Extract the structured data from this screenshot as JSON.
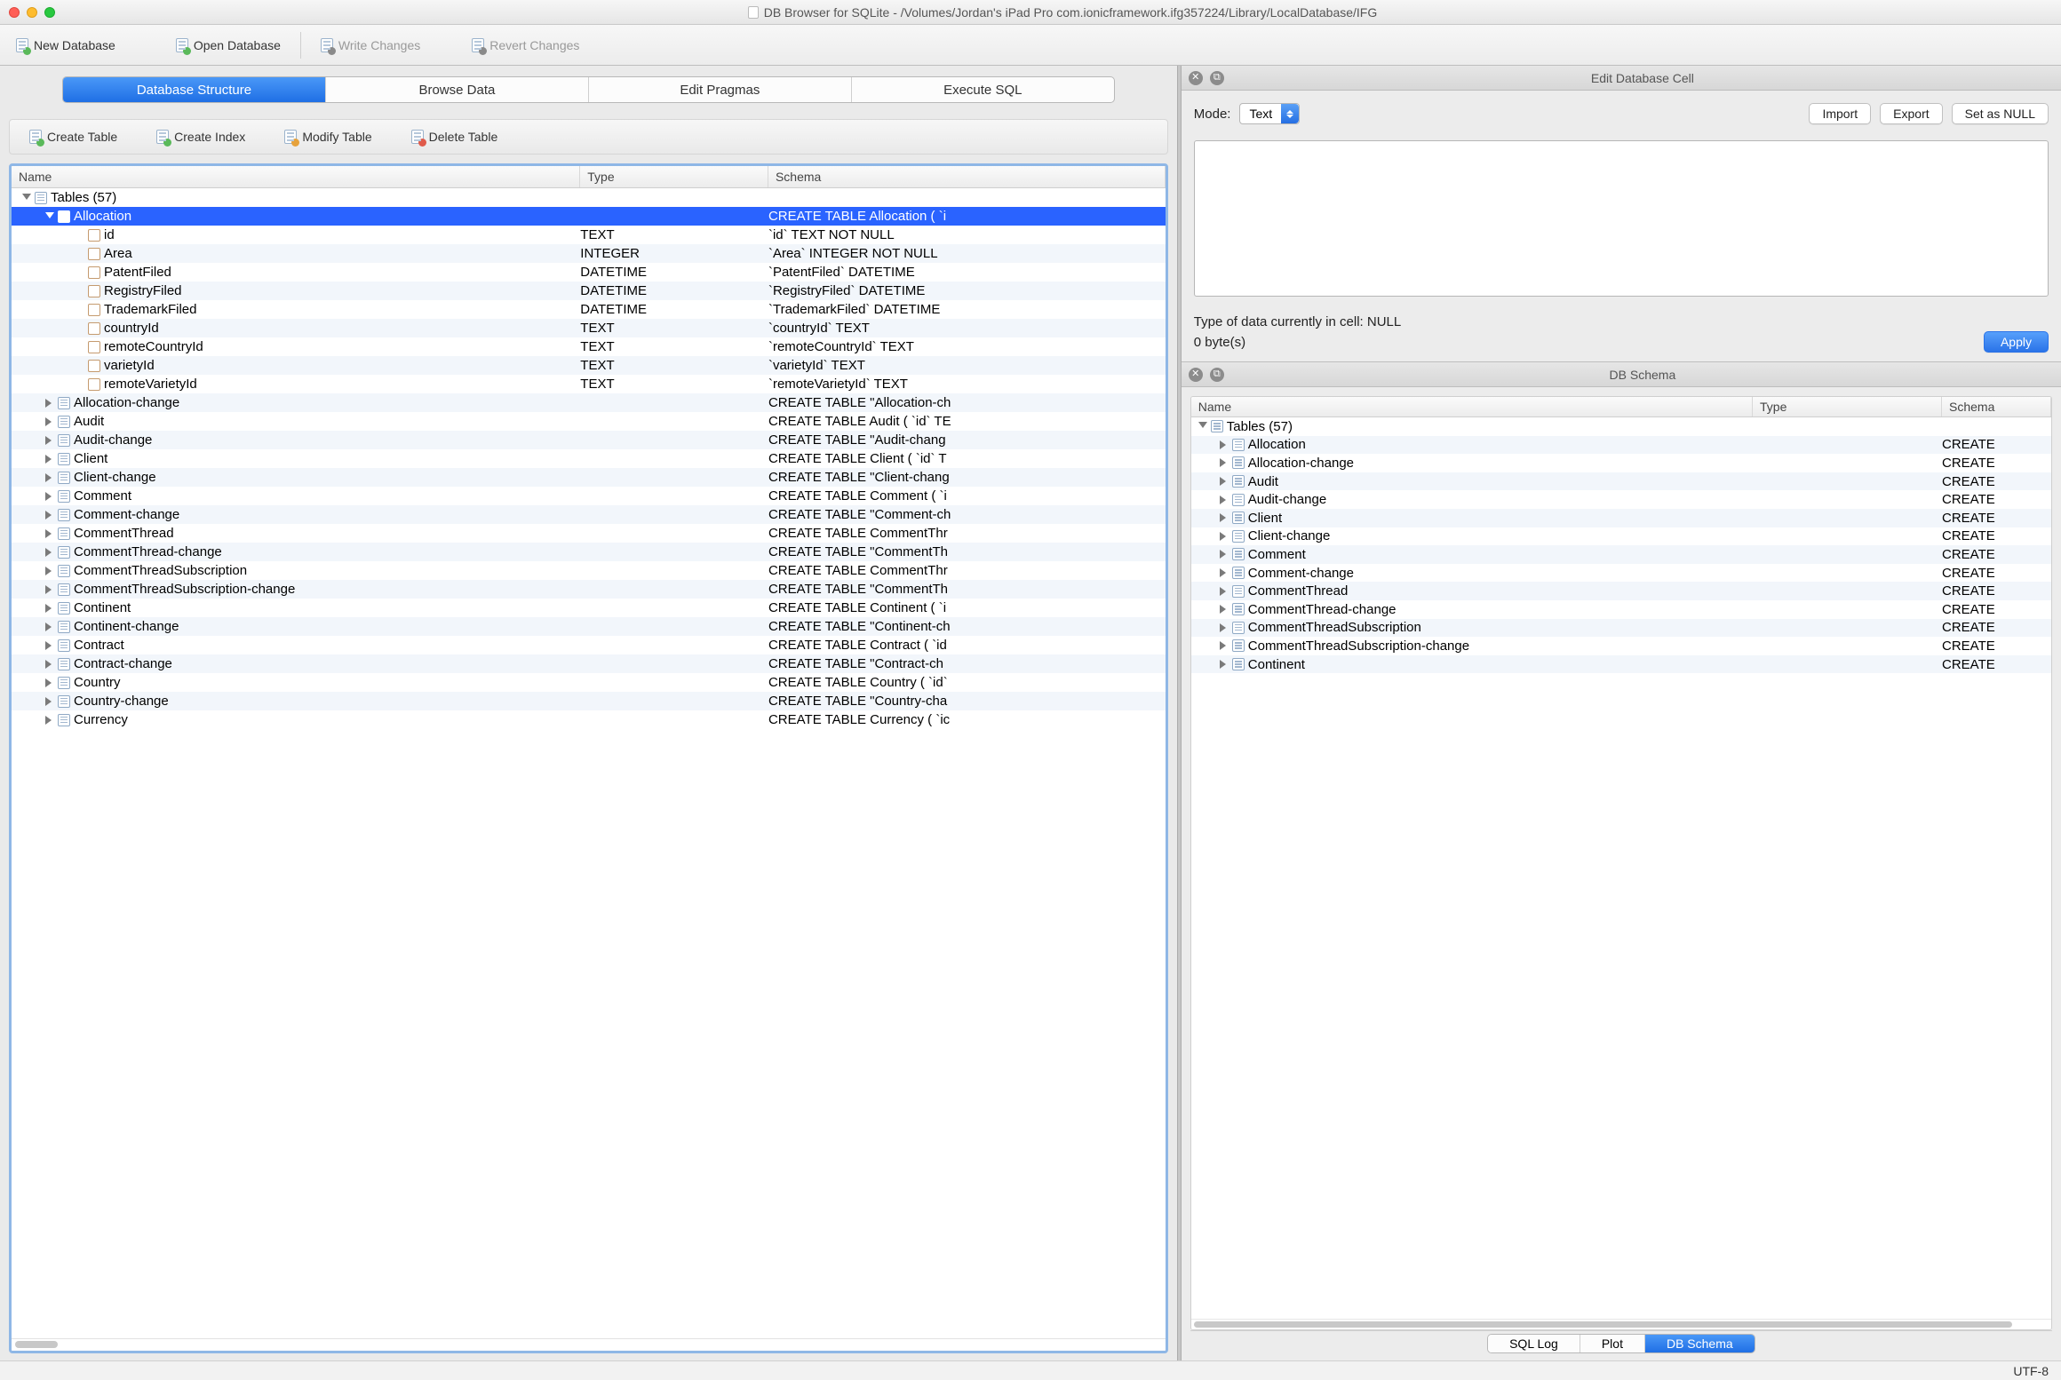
{
  "window": {
    "title": "DB Browser for SQLite - /Volumes/Jordan's iPad Pro com.ionicframework.ifg357224/Library/LocalDatabase/IFG"
  },
  "toolbar": {
    "new_db": "New Database",
    "open_db": "Open Database",
    "write_changes": "Write Changes",
    "revert_changes": "Revert Changes"
  },
  "main_tabs": {
    "structure": "Database Structure",
    "browse": "Browse Data",
    "pragmas": "Edit Pragmas",
    "execute": "Execute SQL"
  },
  "inner_toolbar": {
    "create_table": "Create Table",
    "create_index": "Create Index",
    "modify_table": "Modify Table",
    "delete_table": "Delete Table"
  },
  "tree_headers": {
    "name": "Name",
    "type": "Type",
    "schema": "Schema"
  },
  "tables_header": "Tables (57)",
  "allocation": {
    "name": "Allocation",
    "schema": "CREATE TABLE Allocation ( `i",
    "cols": [
      {
        "name": "id",
        "type": "TEXT",
        "schema": "`id` TEXT NOT NULL"
      },
      {
        "name": "Area",
        "type": "INTEGER",
        "schema": "`Area` INTEGER NOT NULL"
      },
      {
        "name": "PatentFiled",
        "type": "DATETIME",
        "schema": "`PatentFiled` DATETIME"
      },
      {
        "name": "RegistryFiled",
        "type": "DATETIME",
        "schema": "`RegistryFiled` DATETIME"
      },
      {
        "name": "TrademarkFiled",
        "type": "DATETIME",
        "schema": "`TrademarkFiled` DATETIME"
      },
      {
        "name": "countryId",
        "type": "TEXT",
        "schema": "`countryId` TEXT"
      },
      {
        "name": "remoteCountryId",
        "type": "TEXT",
        "schema": "`remoteCountryId` TEXT"
      },
      {
        "name": "varietyId",
        "type": "TEXT",
        "schema": "`varietyId` TEXT"
      },
      {
        "name": "remoteVarietyId",
        "type": "TEXT",
        "schema": "`remoteVarietyId` TEXT"
      }
    ]
  },
  "other_tables": [
    {
      "name": "Allocation-change",
      "schema": "CREATE TABLE \"Allocation-ch"
    },
    {
      "name": "Audit",
      "schema": "CREATE TABLE Audit ( `id` TE"
    },
    {
      "name": "Audit-change",
      "schema": "CREATE TABLE \"Audit-chang"
    },
    {
      "name": "Client",
      "schema": "CREATE TABLE Client ( `id` T"
    },
    {
      "name": "Client-change",
      "schema": "CREATE TABLE \"Client-chang"
    },
    {
      "name": "Comment",
      "schema": "CREATE TABLE Comment ( `i"
    },
    {
      "name": "Comment-change",
      "schema": "CREATE TABLE \"Comment-ch"
    },
    {
      "name": "CommentThread",
      "schema": "CREATE TABLE CommentThr"
    },
    {
      "name": "CommentThread-change",
      "schema": "CREATE TABLE \"CommentTh"
    },
    {
      "name": "CommentThreadSubscription",
      "schema": "CREATE TABLE CommentThr"
    },
    {
      "name": "CommentThreadSubscription-change",
      "schema": "CREATE TABLE \"CommentTh"
    },
    {
      "name": "Continent",
      "schema": "CREATE TABLE Continent ( `i"
    },
    {
      "name": "Continent-change",
      "schema": "CREATE TABLE \"Continent-ch"
    },
    {
      "name": "Contract",
      "schema": "CREATE TABLE Contract ( `id"
    },
    {
      "name": "Contract-change",
      "schema": "CREATE TABLE \"Contract-ch"
    },
    {
      "name": "Country",
      "schema": "CREATE TABLE Country ( `id`"
    },
    {
      "name": "Country-change",
      "schema": "CREATE TABLE \"Country-cha"
    },
    {
      "name": "Currency",
      "schema": "CREATE TABLE Currency ( `ic"
    }
  ],
  "edit_cell": {
    "title": "Edit Database Cell",
    "mode_label": "Mode:",
    "mode_value": "Text",
    "import": "Import",
    "export": "Export",
    "set_null": "Set as NULL",
    "type_line": "Type of data currently in cell: NULL",
    "size_line": "0 byte(s)",
    "apply": "Apply"
  },
  "schema_panel": {
    "title": "DB Schema",
    "headers": {
      "name": "Name",
      "type": "Type",
      "schema": "Schema"
    },
    "tables_header": "Tables (57)",
    "rows": [
      {
        "name": "Allocation",
        "schema": "CREATE"
      },
      {
        "name": "Allocation-change",
        "schema": "CREATE"
      },
      {
        "name": "Audit",
        "schema": "CREATE"
      },
      {
        "name": "Audit-change",
        "schema": "CREATE"
      },
      {
        "name": "Client",
        "schema": "CREATE"
      },
      {
        "name": "Client-change",
        "schema": "CREATE"
      },
      {
        "name": "Comment",
        "schema": "CREATE"
      },
      {
        "name": "Comment-change",
        "schema": "CREATE"
      },
      {
        "name": "CommentThread",
        "schema": "CREATE"
      },
      {
        "name": "CommentThread-change",
        "schema": "CREATE"
      },
      {
        "name": "CommentThreadSubscription",
        "schema": "CREATE"
      },
      {
        "name": "CommentThreadSubscription-change",
        "schema": "CREATE"
      },
      {
        "name": "Continent",
        "schema": "CREATE"
      }
    ]
  },
  "bottom_tabs": {
    "sqllog": "SQL Log",
    "plot": "Plot",
    "dbschema": "DB Schema"
  },
  "statusbar": {
    "encoding": "UTF-8"
  }
}
